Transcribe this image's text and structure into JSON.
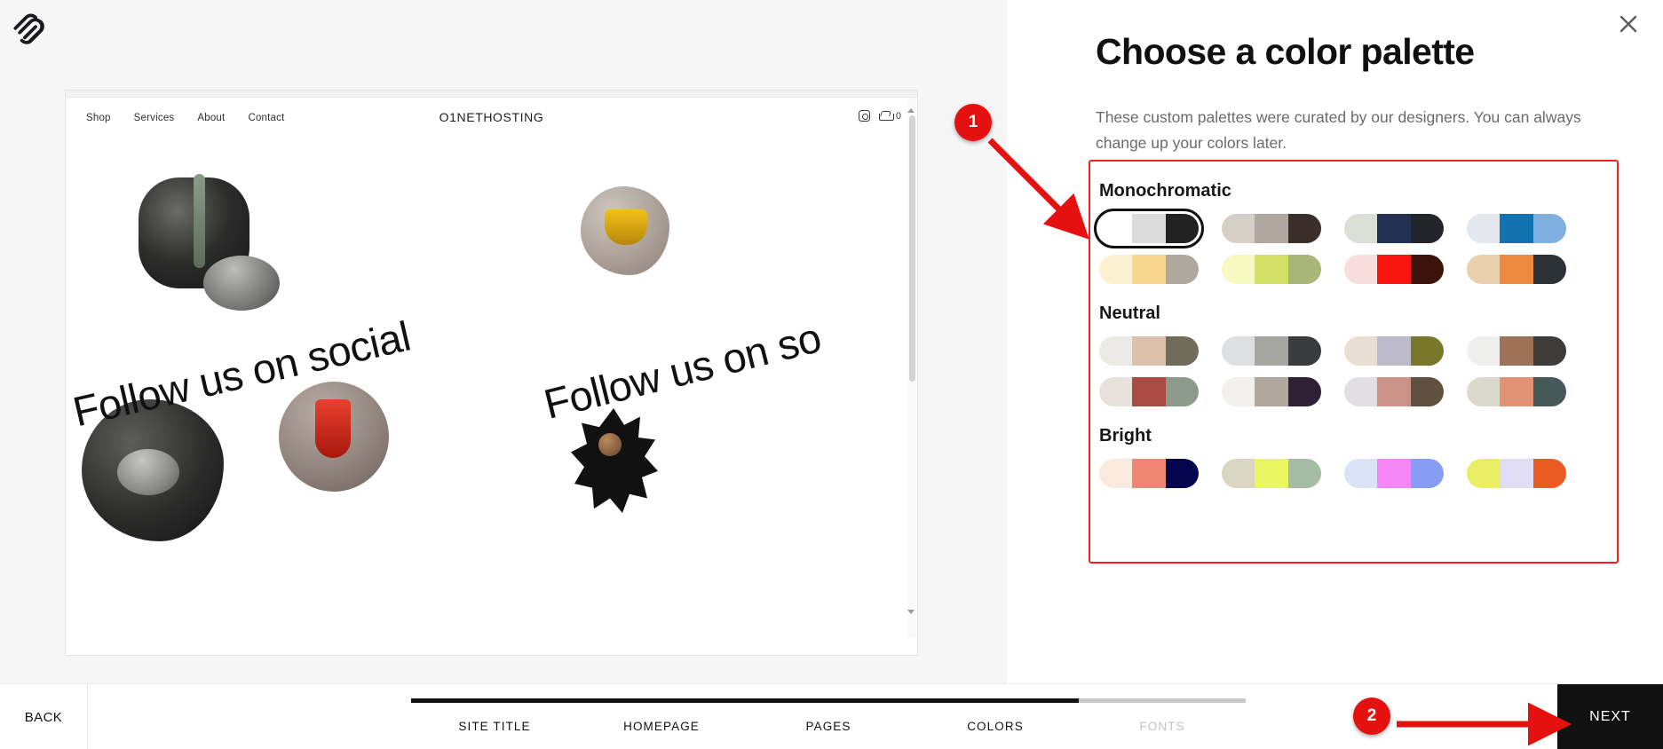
{
  "app": {
    "logo_icon": "squarespace-logo",
    "close_icon": "close-icon"
  },
  "preview": {
    "nav_items": [
      "Shop",
      "Services",
      "About",
      "Contact"
    ],
    "site_title": "O1NETHOSTING",
    "instagram_icon": "instagram-icon",
    "cart_icon": "shopping-cart-icon",
    "cart_count": "0",
    "marquee_left": "l  Follow us on social",
    "marquee_right": "Follow us on so"
  },
  "panel": {
    "title": "Choose a color palette",
    "subtitle": "These custom palettes were curated by our designers. You can always change up your colors later.",
    "highlight_color": "#ef2020",
    "groups": [
      {
        "name": "Monochromatic",
        "palettes": [
          {
            "id": "mono-1",
            "selected": true,
            "colors": [
              "#ffffff",
              "#dcdcdc",
              "#222222"
            ]
          },
          {
            "id": "mono-2",
            "selected": false,
            "colors": [
              "#d5cfc7",
              "#9a8removed",
              "#3a2f2a"
            ]
          },
          {
            "id": "mono-3",
            "selected": false,
            "colors": [
              "#dcded8",
              "#233252",
              "#23252a"
            ]
          },
          {
            "id": "mono-4",
            "selected": false,
            "colors": [
              "#e4e7ee",
              "#1272b0",
              "#7fb0e0"
            ]
          },
          {
            "id": "mono-5",
            "selected": false,
            "colors": [
              "#fbf0cf",
              "#f7d88c",
              "#fac council"
            ]
          },
          {
            "id": "mono-6",
            "selected": false,
            "colors": [
              "#f7f9c2",
              "#d2e065",
              "#a9b579"
            ]
          },
          {
            "id": "mono-7",
            "selected": false,
            "colors": [
              "#f8dedc",
              "#fb1410",
              "#3b120c"
            ]
          },
          {
            "id": "mono-8",
            "selected": false,
            "colors": [
              "#ecd0ad",
              "#ee8a40",
              "#2c3138"
            ]
          }
        ]
      },
      {
        "name": "Neutral",
        "palettes": [
          {
            "id": "neu-1",
            "selected": false,
            "colors": [
              "#eceae7",
              "#ddc2ab",
              "#6f6c5c"
            ]
          },
          {
            "id": "neu-2",
            "selected": false,
            "colors": [
              "#dddfe1",
              "#a5a6a1",
              "#3a3b3c"
            ]
          },
          {
            "id": "neu-3",
            "selected": false,
            "colors": [
              "#e7dfd4",
              "#bcbacb",
              "#77782a"
            ]
          },
          {
            "id": "neu-4",
            "selected": false,
            "colors": [
              "#eff0ed",
              "#9d7256",
              "#3e3c3a"
            ]
          },
          {
            "id": "neu-5",
            "selected": false,
            "colors": [
              "#e7e3dc",
              "#ab4a42",
              "#8e9b8c"
            ]
          },
          {
            "id": "neu-6",
            "selected": false,
            "colors": [
              "#f1f0ec",
              "#cba madh77",
              "#2e2135"
            ]
          },
          {
            "id": "neu-7",
            "selected": false,
            "colors": [
              "#e2dfe4",
              "#ca9289",
              "#60503f"
            ]
          },
          {
            "id": "neu-8",
            "selected": false,
            "colors": [
              "#dcd9cd",
              "#e09477",
              "#46585a"
            ]
          }
        ]
      },
      {
        "name": "Bright",
        "palettes": [
          {
            "id": "bri-1",
            "selected": false,
            "colors": [
              "#faeade",
              "#ef8775",
              "#030450"
            ]
          },
          {
            "id": "bri-2",
            "selected": false,
            "colors": [
              "#dbd5c3",
              "#e9f860",
              "#a6bba4"
            ]
          },
          {
            "id": "bri-3",
            "selected": false,
            "colors": [
              "#dbe4f7",
              "#f487f7",
              "#879cf3"
            ]
          },
          {
            "id": "bri-4",
            "selected": false,
            "colors": [
              "#eaee65",
              "#e2ddf6",
              "#ea5c23"
            ]
          }
        ]
      }
    ]
  },
  "footer": {
    "back_label": "BACK",
    "next_label": "NEXT",
    "progress_percent": 80,
    "steps": [
      {
        "label": "SITE TITLE",
        "active": true
      },
      {
        "label": "HOMEPAGE",
        "active": true
      },
      {
        "label": "PAGES",
        "active": true
      },
      {
        "label": "COLORS",
        "active": true
      },
      {
        "label": "FONTS",
        "active": false
      }
    ]
  },
  "annotations": [
    {
      "id": "1",
      "label": "1"
    },
    {
      "id": "2",
      "label": "2"
    }
  ]
}
